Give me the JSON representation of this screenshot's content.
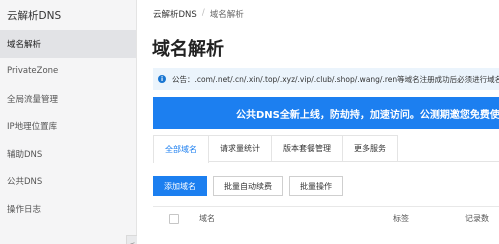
{
  "sidebar": {
    "brand": "云解析DNS",
    "items": [
      {
        "label": "域名解析",
        "active": true
      },
      {
        "label": "PrivateZone"
      },
      {
        "label": "全局流量管理"
      },
      {
        "label": "IP地理位置库"
      },
      {
        "label": "辅助DNS"
      },
      {
        "label": "公共DNS"
      },
      {
        "label": "操作日志"
      }
    ],
    "collapse_glyph": "<"
  },
  "breadcrumb": {
    "root": "云解析DNS",
    "sep": "/",
    "current": "域名解析"
  },
  "page_title": "域名解析",
  "notice": {
    "icon": "i",
    "text": "公告：.com/.net/.cn/.xin/.top/.xyz/.vip/.club/.shop/.wang/.ren等域名注册成功后必须进行域名"
  },
  "banner": {
    "text": "公共DNS全新上线，防劫持，加速访问。公测期邀您免费使用"
  },
  "tabs": [
    {
      "label": "全部域名",
      "active": true
    },
    {
      "label": "请求量统计"
    },
    {
      "label": "版本套餐管理"
    },
    {
      "label": "更多服务"
    }
  ],
  "actions": {
    "add": "添加域名",
    "auto_renew": "批量自动续费",
    "batch": "批量操作"
  },
  "table": {
    "headers": {
      "domain": "域名",
      "tag": "标签",
      "records": "记录数"
    }
  },
  "colors": {
    "accent": "#1c7ff0",
    "notice_bg": "#ebf4fc",
    "sidebar_bg": "#f5f5f6"
  }
}
